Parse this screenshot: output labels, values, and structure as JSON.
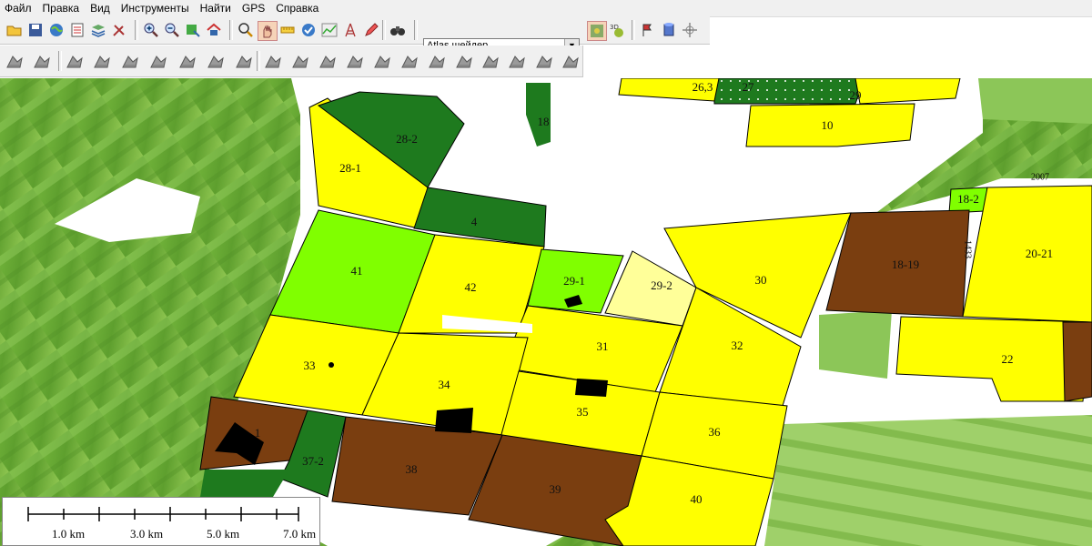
{
  "menu": [
    "Файл",
    "Правка",
    "Вид",
    "Инструменты",
    "Найти",
    "GPS",
    "Справка"
  ],
  "toolbar1": {
    "shader_select_value": "Atlas шейдер",
    "buttons": [
      "open-folder-icon",
      "save-icon",
      "globe-icon",
      "layers-icon",
      "stack-icon",
      "tools-icon",
      "zoom-in-icon",
      "zoom-out-icon",
      "map-export-icon",
      "home-icon",
      "magnifier-icon",
      "hand-pan-icon",
      "measure-ruler-icon",
      "identify-icon",
      "chart-icon",
      "tower-icon",
      "draw-pencil-icon",
      "binoculars-icon",
      "shader-settings-icon",
      "3d-view-icon",
      "flag-icon",
      "cylinder-icon",
      "crosshair-icon"
    ]
  },
  "toolbar2": {
    "buttons": [
      "edit-tool-1-icon",
      "edit-tool-2-icon",
      "edit-tool-3-icon",
      "edit-tool-4-icon",
      "edit-tool-5-icon",
      "edit-tool-6-icon",
      "edit-tool-7-icon",
      "edit-tool-8-icon",
      "edit-tool-9-icon",
      "edit-tool-10-icon",
      "edit-tool-11-icon",
      "edit-tool-12-icon",
      "edit-tool-13-icon",
      "edit-tool-14-icon",
      "edit-tool-15-icon",
      "edit-tool-16-icon",
      "edit-tool-17-icon",
      "edit-tool-18-icon",
      "edit-tool-19-icon",
      "edit-tool-20-icon",
      "edit-tool-21-icon",
      "edit-tool-22-icon",
      "edit-tool-23-icon",
      "edit-tool-24-icon",
      "edit-tool-25-icon",
      "edit-tool-26-icon",
      "edit-tool-27-icon",
      "edit-tool-28-icon"
    ]
  },
  "colors": {
    "field_yellow": "#ffff00",
    "field_pale_yellow": "#ffff99",
    "field_light_green": "#80ff00",
    "field_dark_green": "#1e7a1e",
    "field_brown": "#7a3e10",
    "background_green": "#6fae3a"
  },
  "fields": [
    {
      "id": "field-26-3",
      "label": "26,3"
    },
    {
      "id": "field-27",
      "label": "27"
    },
    {
      "id": "field-28-1",
      "label": "28-1"
    },
    {
      "id": "field-28-2",
      "label": "28-2"
    },
    {
      "id": "field-29",
      "label": "29"
    },
    {
      "id": "field-18",
      "label": "18"
    },
    {
      "id": "field-10",
      "label": "10"
    },
    {
      "id": "field-4",
      "label": "4"
    },
    {
      "id": "field-18-2",
      "label": "18-2"
    },
    {
      "id": "field-41",
      "label": "41"
    },
    {
      "id": "field-42",
      "label": "42"
    },
    {
      "id": "field-29-1",
      "label": "29-1"
    },
    {
      "id": "field-29-2",
      "label": "29-2"
    },
    {
      "id": "field-30",
      "label": "30"
    },
    {
      "id": "field-18-19",
      "label": "18-19"
    },
    {
      "id": "field-20-21",
      "label": "20-21"
    },
    {
      "id": "field-31",
      "label": "31"
    },
    {
      "id": "field-32",
      "label": "32"
    },
    {
      "id": "field-33",
      "label": "33"
    },
    {
      "id": "field-34",
      "label": "34"
    },
    {
      "id": "field-35",
      "label": "35"
    },
    {
      "id": "field-22",
      "label": "22"
    },
    {
      "id": "field-36",
      "label": "36"
    },
    {
      "id": "field-1",
      "label": "1"
    },
    {
      "id": "field-37-2",
      "label": "37-2"
    },
    {
      "id": "field-38",
      "label": "38"
    },
    {
      "id": "field-39",
      "label": "39"
    },
    {
      "id": "field-40",
      "label": "40"
    }
  ],
  "map_notes": {
    "year": "2007",
    "number": "1433"
  },
  "scale_bar": {
    "labels": [
      "1.0 km",
      "3.0 km",
      "5.0 km",
      "7.0 km"
    ]
  }
}
